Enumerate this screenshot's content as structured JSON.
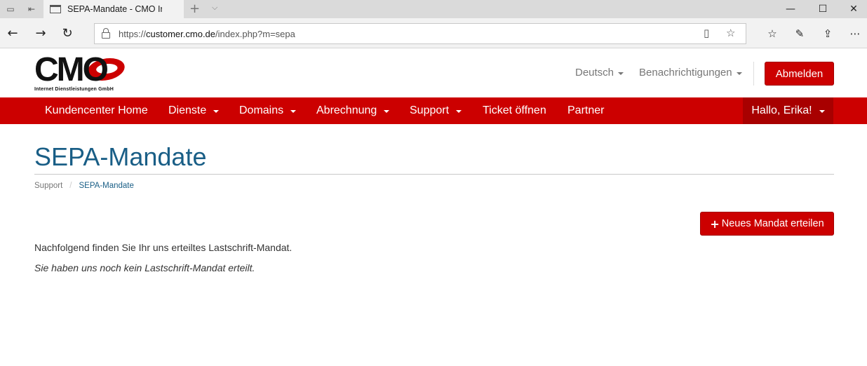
{
  "browser": {
    "tab_title": "SEPA-Mandate - CMO Internet Dienstleistungen GmbH",
    "tab_close": "×",
    "new_tab": "+",
    "tab_dropdown": "⌵",
    "url_host": "customer.cmo.de",
    "url_scheme": "https://",
    "url_path": "/index.php?m=sepa",
    "window_controls": {
      "minimize": "—",
      "maximize": "☐",
      "close": "✕"
    },
    "nav": {
      "back": "←",
      "forward": "→",
      "refresh": "↻"
    },
    "icons": [
      "tab-preview-icon",
      "set-aside-tabs-icon",
      "reading-view-icon",
      "favorite-star-icon",
      "favorites-hub-icon",
      "pen-icon",
      "share-icon",
      "more-icon"
    ]
  },
  "site": {
    "logo_text": "CMO",
    "logo_tagline": "Internet Dienstleistungen GmbH",
    "language": "Deutsch",
    "notifications": "Benachrichtigungen",
    "logout": "Abmelden",
    "accent_color": "#cc0000",
    "title_color": "#195e86"
  },
  "navbar": {
    "items": [
      "Kundencenter Home",
      "Dienste",
      "Domains",
      "Abrechnung",
      "Support",
      "Ticket öffnen",
      "Partner"
    ],
    "user": "Hallo, Erika!"
  },
  "main": {
    "title": "SEPA-Mandate",
    "breadcrumb": [
      "Support",
      "SEPA-Mandate"
    ],
    "new_button": "Neues Mandat erteilen",
    "intro": "Nachfolgend finden Sie Ihr uns erteiltes Lastschrift-Mandat.",
    "empty": "Sie haben uns noch kein Lastschrift-Mandat erteilt."
  }
}
